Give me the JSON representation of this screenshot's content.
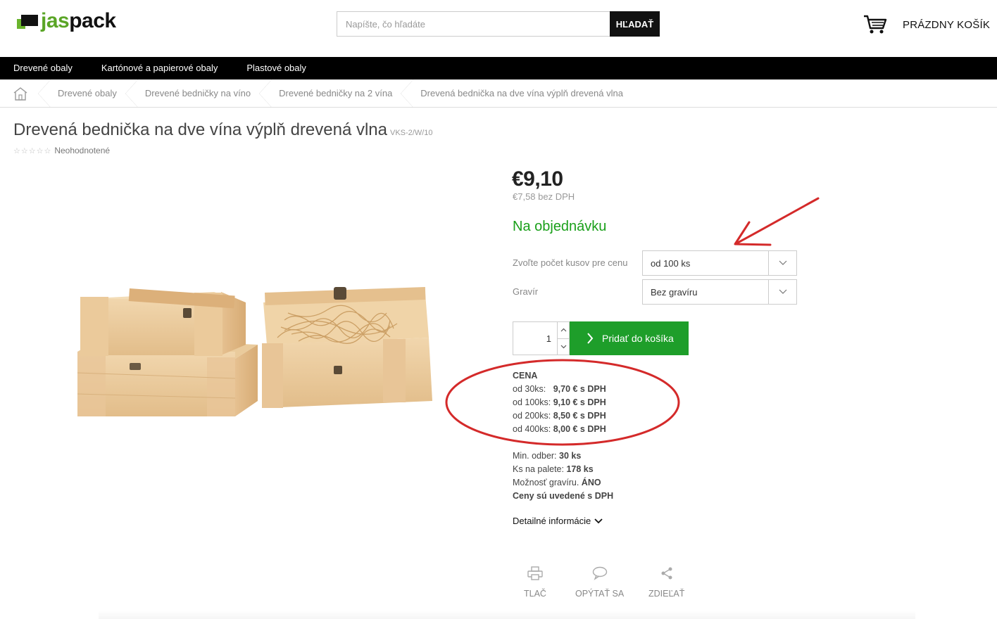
{
  "header": {
    "logo": {
      "part1": "jas",
      "part2": "pack"
    },
    "search": {
      "placeholder": "Napíšte, čo hľadáte",
      "button_label": "HĽADAŤ"
    },
    "cart_label": "PRÁZDNY KOŠÍK"
  },
  "nav": {
    "items": [
      "Drevené obaly",
      "Kartónové a papierové obaly",
      "Plastové obaly"
    ]
  },
  "breadcrumb": {
    "items": [
      "Drevené obaly",
      "Drevené bedničky na víno",
      "Drevené bedničky na 2 vína",
      "Drevená bednička na dve vína výplň drevená vlna"
    ]
  },
  "product": {
    "title": "Drevená bednička na dve vína výplň drevená vlna",
    "sku": "VKS-2/W/10",
    "rating_label": "Neohodnotené",
    "price": "€9,10",
    "price_net": "€7,58 bez DPH",
    "availability": "Na objednávku",
    "options": [
      {
        "label": "Zvoľte počet kusov pre cenu",
        "value": "od 100 ks"
      },
      {
        "label": "Gravír",
        "value": "Bez gravíru"
      }
    ],
    "quantity": "1",
    "add_to_cart_label": "Pridať do košíka",
    "price_table": {
      "heading": "CENA",
      "rows": [
        {
          "label": "od 30ks:",
          "value": "9,70 € s DPH"
        },
        {
          "label": "od 100ks:",
          "value": "9,10 € s DPH"
        },
        {
          "label": "od 200ks:",
          "value": "8,50 € s DPH"
        },
        {
          "label": "od 400ks:",
          "value": "8,00 € s DPH"
        }
      ]
    },
    "meta": [
      {
        "label": "Min. odber:",
        "value": "30 ks"
      },
      {
        "label": "Ks na palete:",
        "value": "178 ks"
      },
      {
        "label": "Možnosť gravíru.",
        "value": "ÁNO"
      }
    ],
    "vat_note": "Ceny sú uvedené s DPH",
    "details_link": "Detailné informácie"
  },
  "actions": [
    "TLAČ",
    "OPÝTAŤ SA",
    "ZDIEĽAŤ"
  ],
  "colors": {
    "brand_green": "#5aa526",
    "button_green": "#1e9e2a",
    "availability_green": "#1aa01a",
    "annotation_red": "#d42a2a"
  }
}
